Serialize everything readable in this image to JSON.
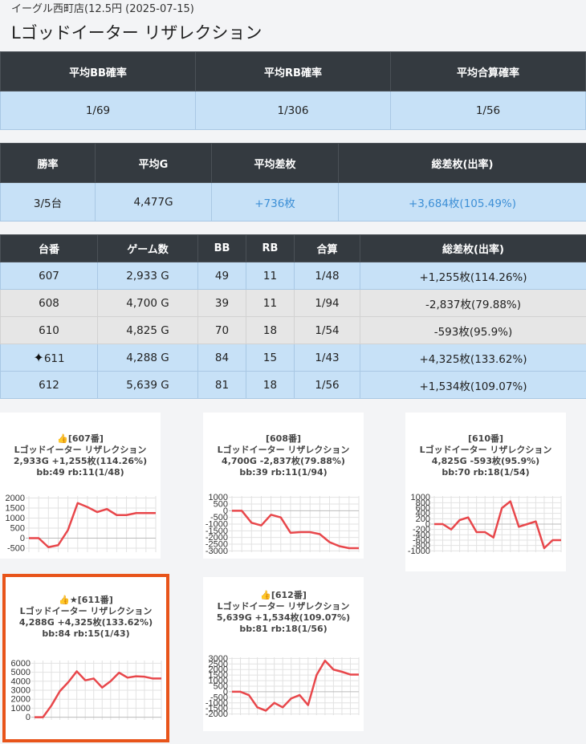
{
  "store_subtitle": "イーグル西町店(12.5円 (2025-07-15)",
  "machine_title": "Lゴッドイーター リザレクション",
  "summary1": {
    "headers": [
      "平均BB確率",
      "平均RB確率",
      "平均合算確率"
    ],
    "values": [
      "1/69",
      "1/306",
      "1/56"
    ]
  },
  "summary2": {
    "headers": [
      "勝率",
      "平均G",
      "平均差枚",
      "総差枚(出率)"
    ],
    "values": [
      "3/5台",
      "4,477G",
      "+736枚",
      "+3,684枚(105.49%)"
    ]
  },
  "machines": {
    "headers": [
      "台番",
      "ゲーム数",
      "BB",
      "RB",
      "合算",
      "総差枚(出率)"
    ],
    "rows": [
      {
        "no": "607",
        "games": "2,933 G",
        "bb": "49",
        "rb": "11",
        "total": "1/48",
        "diff": "+1,255枚(114.26%)",
        "style": "blue",
        "star": false
      },
      {
        "no": "608",
        "games": "4,700 G",
        "bb": "39",
        "rb": "11",
        "total": "1/94",
        "diff": "-2,837枚(79.88%)",
        "style": "gray",
        "star": false
      },
      {
        "no": "610",
        "games": "4,825 G",
        "bb": "70",
        "rb": "18",
        "total": "1/54",
        "diff": "-593枚(95.9%)",
        "style": "gray",
        "star": false
      },
      {
        "no": "611",
        "games": "4,288 G",
        "bb": "84",
        "rb": "15",
        "total": "1/43",
        "diff": "+4,325枚(133.62%)",
        "style": "blue",
        "star": true
      },
      {
        "no": "612",
        "games": "5,639 G",
        "bb": "81",
        "rb": "18",
        "total": "1/56",
        "diff": "+1,534枚(109.07%)",
        "style": "blue",
        "star": false
      }
    ]
  },
  "cards": [
    {
      "line1": "👍[607番]",
      "line2": "Lゴッドイーター リザレクション",
      "line3": "2,933G +1,255枚(114.26%)",
      "line4": "bb:49 rb:11(1/48)"
    },
    {
      "line1": "[608番]",
      "line2": "Lゴッドイーター リザレクション",
      "line3": "4,700G -2,837枚(79.88%)",
      "line4": "bb:39 rb:11(1/94)"
    },
    {
      "line1": "[610番]",
      "line2": "Lゴッドイーター リザレクション",
      "line3": "4,825G -593枚(95.9%)",
      "line4": "bb:70 rb:18(1/54)"
    },
    {
      "line1": "👍★[611番]",
      "line2": "Lゴッドイーター リザレクション",
      "line3": "4,288G +4,325枚(133.62%)",
      "line4": "bb:84 rb:15(1/43)"
    },
    {
      "line1": "👍[612番]",
      "line2": "Lゴッドイーター リザレクション",
      "line3": "5,639G +1,534枚(109.07%)",
      "line4": "bb:81 rb:18(1/56)"
    }
  ],
  "chart_data": [
    {
      "type": "line",
      "ylim": [
        -700,
        2100
      ],
      "yticks": [
        -500,
        0,
        500,
        1000,
        1500,
        2000
      ],
      "color": "#e8474b",
      "values": [
        0,
        0,
        -450,
        -350,
        400,
        1750,
        1550,
        1300,
        1450,
        1150,
        1150,
        1250,
        1250,
        1250
      ]
    },
    {
      "type": "line",
      "ylim": [
        -3100,
        1100
      ],
      "yticks": [
        -3000,
        -2500,
        -2000,
        -1500,
        -1000,
        -500,
        0,
        500,
        1000
      ],
      "color": "#e8474b",
      "values": [
        0,
        0,
        -900,
        -1100,
        -300,
        -500,
        -1650,
        -1600,
        -1600,
        -1750,
        -2350,
        -2650,
        -2800,
        -2800
      ]
    },
    {
      "type": "line",
      "ylim": [
        -1050,
        1050
      ],
      "yticks": [
        -1000,
        -800,
        -600,
        -400,
        -200,
        0,
        200,
        400,
        600,
        800,
        1000
      ],
      "color": "#e8474b",
      "values": [
        0,
        0,
        -200,
        150,
        250,
        -300,
        -300,
        -500,
        600,
        850,
        -100,
        0,
        100,
        -900,
        -600,
        -600
      ]
    },
    {
      "type": "line",
      "ylim": [
        -300,
        6300
      ],
      "yticks": [
        0,
        1000,
        2000,
        3000,
        4000,
        5000,
        6000
      ],
      "color": "#e8474b",
      "values": [
        0,
        0,
        1300,
        2900,
        3900,
        5100,
        4100,
        4300,
        3300,
        4000,
        4950,
        4400,
        4550,
        4500,
        4300,
        4300
      ]
    },
    {
      "type": "line",
      "ylim": [
        -2100,
        3100
      ],
      "yticks": [
        -2000,
        -1500,
        -1000,
        -500,
        0,
        500,
        1000,
        1500,
        2000,
        2500,
        3000
      ],
      "color": "#e8474b",
      "values": [
        0,
        0,
        -300,
        -1400,
        -1700,
        -1000,
        -1400,
        -600,
        -300,
        -1200,
        1500,
        2800,
        2000,
        1800,
        1550,
        1550
      ]
    }
  ]
}
